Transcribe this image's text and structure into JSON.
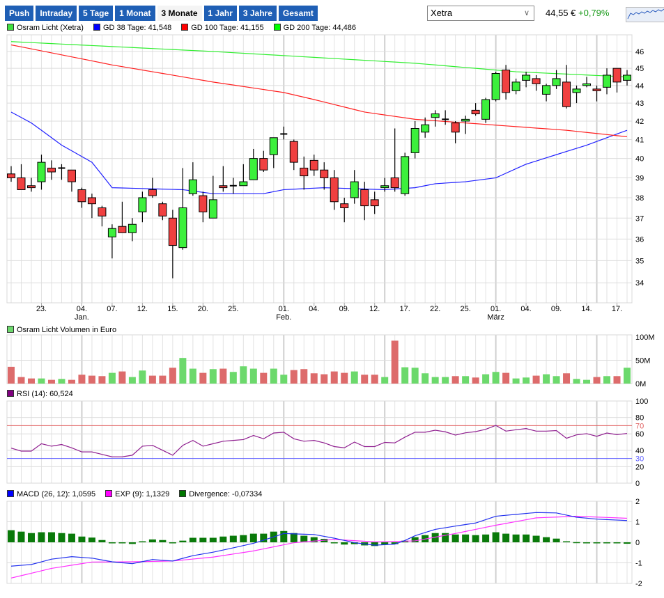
{
  "tabs": [
    {
      "label": "Push"
    },
    {
      "label": "Intraday"
    },
    {
      "label": "5 Tage"
    },
    {
      "label": "1 Monat"
    },
    {
      "label": "3 Monate",
      "active": true
    },
    {
      "label": "1 Jahr"
    },
    {
      "label": "3 Jahre"
    },
    {
      "label": "Gesamt"
    }
  ],
  "exchange_select": {
    "value": "Xetra"
  },
  "quote": {
    "price": "44,55 €",
    "change": "+0,79%"
  },
  "legend_price": [
    {
      "label": "Osram Licht (Xetra)",
      "color": "#40e040"
    },
    {
      "label": "GD 38 Tage: 41,548",
      "color": "#0000ff"
    },
    {
      "label": "GD 100 Tage: 41,155",
      "color": "#ff0000"
    },
    {
      "label": "GD 200 Tage: 44,486",
      "color": "#00ff00"
    }
  ],
  "legend_volume": {
    "label": "Osram Licht Volumen in Euro",
    "color": "#6cd96c"
  },
  "legend_rsi": {
    "label": "RSI (14): 60,524",
    "color": "#800080"
  },
  "legend_macd": [
    {
      "label": "MACD (26, 12): 1,0595",
      "color": "#0000ff"
    },
    {
      "label": "EXP (9): 1,1329",
      "color": "#ff00ff"
    },
    {
      "label": "Divergence: -0,07334",
      "color": "#007700"
    }
  ],
  "colors": {
    "up": "#3cf03c",
    "down": "#f04040",
    "vol_up": "#6cd96c",
    "vol_down": "#dd6b6b",
    "div": "#0a7a0a"
  },
  "chart_data": [
    {
      "type": "candlestick",
      "title": "Osram Licht (Xetra)",
      "yscale": "log",
      "ylim": [
        33.2,
        47
      ],
      "yticks": [
        34,
        35,
        36,
        37,
        38,
        39,
        40,
        41,
        42,
        43,
        44,
        45,
        46
      ],
      "xticks": [
        {
          "i": 3,
          "label": "23."
        },
        {
          "i": 7,
          "label": "04.",
          "month": "Jan."
        },
        {
          "i": 10,
          "label": "07."
        },
        {
          "i": 13,
          "label": "12."
        },
        {
          "i": 16,
          "label": "15."
        },
        {
          "i": 19,
          "label": "20."
        },
        {
          "i": 22,
          "label": "25."
        },
        {
          "i": 27,
          "label": "01.",
          "month": "Feb."
        },
        {
          "i": 30,
          "label": "04."
        },
        {
          "i": 33,
          "label": "09."
        },
        {
          "i": 36,
          "label": "12."
        },
        {
          "i": 39,
          "label": "17."
        },
        {
          "i": 42,
          "label": "22."
        },
        {
          "i": 45,
          "label": "25."
        },
        {
          "i": 48,
          "label": "01.",
          "month": "März"
        },
        {
          "i": 51,
          "label": "04."
        },
        {
          "i": 54,
          "label": "09."
        },
        {
          "i": 57,
          "label": "14."
        },
        {
          "i": 60,
          "label": "17."
        }
      ],
      "ohlc": [
        [
          39.2,
          39.6,
          38.8,
          39.0
        ],
        [
          39.0,
          39.7,
          38.4,
          38.4
        ],
        [
          38.6,
          39.0,
          38.3,
          38.5
        ],
        [
          38.8,
          40.2,
          38.4,
          39.8
        ],
        [
          39.5,
          39.9,
          38.9,
          39.3
        ],
        [
          39.5,
          39.7,
          38.9,
          39.5
        ],
        [
          39.4,
          39.4,
          38.3,
          38.8
        ],
        [
          38.4,
          38.5,
          37.5,
          37.8
        ],
        [
          38.0,
          38.2,
          37.0,
          37.7
        ],
        [
          37.5,
          37.6,
          36.6,
          37.1
        ],
        [
          36.1,
          36.7,
          35.1,
          36.5
        ],
        [
          36.6,
          37.8,
          36.3,
          36.3
        ],
        [
          36.3,
          37.0,
          35.9,
          36.7
        ],
        [
          37.3,
          38.3,
          36.8,
          38.0
        ],
        [
          38.4,
          39.0,
          38.0,
          38.1
        ],
        [
          37.7,
          37.8,
          36.9,
          37.1
        ],
        [
          37.0,
          37.4,
          34.2,
          35.7
        ],
        [
          35.6,
          39.5,
          35.5,
          37.5
        ],
        [
          38.2,
          39.8,
          38.1,
          38.9
        ],
        [
          38.1,
          38.3,
          36.8,
          37.3
        ],
        [
          37.0,
          39.1,
          37.0,
          37.9
        ],
        [
          38.6,
          39.6,
          38.3,
          38.5
        ],
        [
          38.6,
          39.0,
          38.2,
          38.6
        ],
        [
          38.6,
          39.7,
          38.6,
          38.8
        ],
        [
          38.9,
          40.5,
          38.9,
          40.0
        ],
        [
          40.0,
          40.4,
          39.3,
          39.4
        ],
        [
          40.2,
          41.1,
          39.5,
          41.1
        ],
        [
          41.3,
          41.7,
          41.0,
          41.3
        ],
        [
          40.9,
          41.0,
          39.4,
          39.8
        ],
        [
          39.5,
          40.1,
          38.4,
          39.1
        ],
        [
          39.9,
          40.2,
          39.1,
          39.4
        ],
        [
          39.4,
          39.8,
          38.4,
          39.0
        ],
        [
          39.0,
          39.4,
          37.4,
          37.8
        ],
        [
          37.7,
          38.0,
          36.8,
          37.5
        ],
        [
          38.0,
          39.4,
          37.7,
          38.8
        ],
        [
          38.4,
          38.8,
          36.9,
          37.6
        ],
        [
          37.9,
          38.3,
          37.2,
          37.6
        ],
        [
          38.5,
          39.0,
          38.3,
          38.6
        ],
        [
          39.0,
          41.6,
          38.3,
          38.5
        ],
        [
          38.2,
          40.3,
          38.1,
          40.1
        ],
        [
          40.3,
          42.0,
          40.0,
          41.6
        ],
        [
          41.4,
          42.2,
          41.1,
          41.8
        ],
        [
          42.2,
          42.6,
          41.7,
          42.4
        ],
        [
          42.1,
          42.6,
          41.8,
          42.1
        ],
        [
          41.9,
          42.0,
          40.8,
          41.4
        ],
        [
          42.0,
          42.3,
          41.3,
          42.1
        ],
        [
          42.6,
          43.0,
          42.3,
          42.4
        ],
        [
          42.1,
          43.3,
          41.9,
          43.2
        ],
        [
          43.2,
          44.8,
          43.1,
          44.7
        ],
        [
          44.9,
          45.2,
          43.2,
          43.6
        ],
        [
          43.7,
          44.4,
          43.5,
          44.2
        ],
        [
          44.3,
          44.8,
          43.9,
          44.6
        ],
        [
          44.4,
          44.6,
          43.7,
          44.1
        ],
        [
          43.5,
          44.1,
          43.1,
          44.0
        ],
        [
          44.0,
          44.9,
          43.8,
          44.4
        ],
        [
          44.2,
          45.2,
          42.7,
          42.8
        ],
        [
          43.6,
          44.0,
          43.0,
          43.8
        ],
        [
          44.0,
          44.5,
          43.9,
          44.1
        ],
        [
          43.8,
          44.0,
          43.1,
          43.7
        ],
        [
          43.9,
          45.0,
          43.5,
          44.6
        ],
        [
          45.0,
          45.0,
          43.6,
          44.2
        ],
        [
          44.3,
          44.9,
          44.0,
          44.6
        ]
      ],
      "moving_averages": [
        {
          "name": "GD 38",
          "color": "#2020ff",
          "points": [
            [
              0,
              42.5
            ],
            [
              2,
              41.9
            ],
            [
              5,
              40.7
            ],
            [
              8,
              39.8
            ],
            [
              10,
              38.5
            ],
            [
              17,
              38.4
            ],
            [
              20,
              38.2
            ],
            [
              25,
              38.2
            ],
            [
              27,
              38.4
            ],
            [
              31,
              38.5
            ],
            [
              37,
              38.4
            ],
            [
              40,
              38.5
            ],
            [
              42,
              38.7
            ],
            [
              45,
              38.8
            ],
            [
              48,
              39.0
            ],
            [
              51,
              39.7
            ],
            [
              54,
              40.2
            ],
            [
              57,
              40.7
            ],
            [
              61,
              41.5
            ]
          ]
        },
        {
          "name": "GD 100",
          "color": "#ff2020",
          "points": [
            [
              0,
              46.4
            ],
            [
              10,
              45.2
            ],
            [
              20,
              44.2
            ],
            [
              27,
              43.6
            ],
            [
              30,
              43.2
            ],
            [
              35,
              42.5
            ],
            [
              40,
              42.1
            ],
            [
              45,
              41.9
            ],
            [
              50,
              41.7
            ],
            [
              55,
              41.5
            ],
            [
              61,
              41.15
            ]
          ]
        },
        {
          "name": "GD 200",
          "color": "#30ee30",
          "points": [
            [
              0,
              46.6
            ],
            [
              20,
              46.0
            ],
            [
              40,
              45.3
            ],
            [
              50,
              44.8
            ],
            [
              61,
              44.5
            ]
          ]
        }
      ]
    },
    {
      "type": "bar",
      "title": "Osram Licht Volumen in Euro",
      "unit": "M",
      "ylim": [
        0,
        100
      ],
      "yticks": [
        {
          "v": 0,
          "label": "0M"
        },
        {
          "v": 50,
          "label": "50M"
        },
        {
          "v": 100,
          "label": "100M"
        }
      ],
      "values": [
        36,
        14,
        11,
        11,
        8,
        10,
        8,
        19,
        17,
        16,
        23,
        26,
        14,
        28,
        17,
        17,
        34,
        55,
        32,
        23,
        31,
        32,
        25,
        37,
        32,
        23,
        32,
        19,
        29,
        31,
        22,
        20,
        26,
        23,
        26,
        19,
        19,
        14,
        92,
        35,
        34,
        22,
        14,
        14,
        16,
        16,
        13,
        20,
        25,
        23,
        11,
        13,
        17,
        20,
        16,
        22,
        10,
        8,
        14,
        16,
        16,
        34
      ]
    },
    {
      "type": "line",
      "title": "RSI (14)",
      "ylim": [
        0,
        100
      ],
      "yticks": [
        0,
        20,
        30,
        40,
        60,
        70,
        80,
        100
      ],
      "levels": [
        {
          "v": 70,
          "color": "#e06060"
        },
        {
          "v": 30,
          "color": "#6060ff"
        }
      ],
      "values": [
        42.6,
        39,
        39,
        48,
        45,
        47,
        43,
        38,
        38,
        35,
        32,
        32,
        34,
        45,
        46,
        40,
        34,
        46,
        52,
        45,
        48,
        51,
        52,
        53,
        58,
        54,
        61,
        62,
        54,
        51,
        52,
        49,
        44.5,
        43,
        50,
        44.5,
        44.5,
        49.6,
        49,
        56,
        62,
        62,
        64.4,
        62.5,
        58.5,
        61.3,
        62.7,
        65.5,
        70.3,
        63.3,
        65,
        66.4,
        63.3,
        63.3,
        64,
        54.6,
        58.8,
        60.2,
        57,
        61,
        59,
        60.5
      ]
    },
    {
      "type": "line+bar",
      "title": "MACD",
      "ylim": [
        -2,
        2
      ],
      "yticks": [
        -2,
        -1,
        0,
        1,
        2
      ],
      "divergence": [
        0.59,
        0.52,
        0.45,
        0.49,
        0.49,
        0.45,
        0.42,
        0.28,
        0.23,
        0.11,
        -0.02,
        -0.04,
        -0.08,
        0.05,
        0.14,
        0.11,
        -0.01,
        0.08,
        0.22,
        0.22,
        0.22,
        0.28,
        0.32,
        0.35,
        0.42,
        0.42,
        0.52,
        0.55,
        0.45,
        0.32,
        0.25,
        0.17,
        -0.01,
        -0.11,
        -0.09,
        -0.15,
        -0.18,
        -0.11,
        -0.09,
        0.08,
        0.25,
        0.35,
        0.45,
        0.45,
        0.38,
        0.38,
        0.35,
        0.38,
        0.49,
        0.42,
        0.38,
        0.38,
        0.32,
        0.25,
        0.18,
        0.05,
        0.01,
        -0.05,
        -0.05,
        -0.05,
        -0.05,
        -0.07
      ],
      "macd": [
        [
          0,
          -1.16
        ],
        [
          2,
          -1.08
        ],
        [
          4,
          -0.82
        ],
        [
          6,
          -0.7
        ],
        [
          8,
          -0.77
        ],
        [
          10,
          -0.95
        ],
        [
          12,
          -1.04
        ],
        [
          14,
          -0.84
        ],
        [
          16,
          -0.91
        ],
        [
          18,
          -0.65
        ],
        [
          20,
          -0.48
        ],
        [
          22,
          -0.27
        ],
        [
          24,
          -0.05
        ],
        [
          26,
          0.26
        ],
        [
          27,
          0.43
        ],
        [
          28,
          0.41
        ],
        [
          30,
          0.38
        ],
        [
          32,
          0.2
        ],
        [
          34,
          -0.02
        ],
        [
          36,
          -0.14
        ],
        [
          38,
          -0.09
        ],
        [
          39,
          0.09
        ],
        [
          40,
          0.32
        ],
        [
          42,
          0.63
        ],
        [
          44,
          0.79
        ],
        [
          46,
          0.94
        ],
        [
          48,
          1.27
        ],
        [
          50,
          1.36
        ],
        [
          52,
          1.45
        ],
        [
          54,
          1.43
        ],
        [
          56,
          1.22
        ],
        [
          58,
          1.13
        ],
        [
          61,
          1.06
        ]
      ],
      "exp": [
        [
          0,
          -1.74
        ],
        [
          4,
          -1.27
        ],
        [
          8,
          -0.96
        ],
        [
          12,
          -0.95
        ],
        [
          16,
          -0.91
        ],
        [
          20,
          -0.72
        ],
        [
          24,
          -0.42
        ],
        [
          28,
          -0.02
        ],
        [
          32,
          0.14
        ],
        [
          36,
          0.02
        ],
        [
          40,
          0.07
        ],
        [
          44,
          0.43
        ],
        [
          48,
          0.83
        ],
        [
          52,
          1.19
        ],
        [
          56,
          1.27
        ],
        [
          61,
          1.17
        ]
      ]
    }
  ]
}
